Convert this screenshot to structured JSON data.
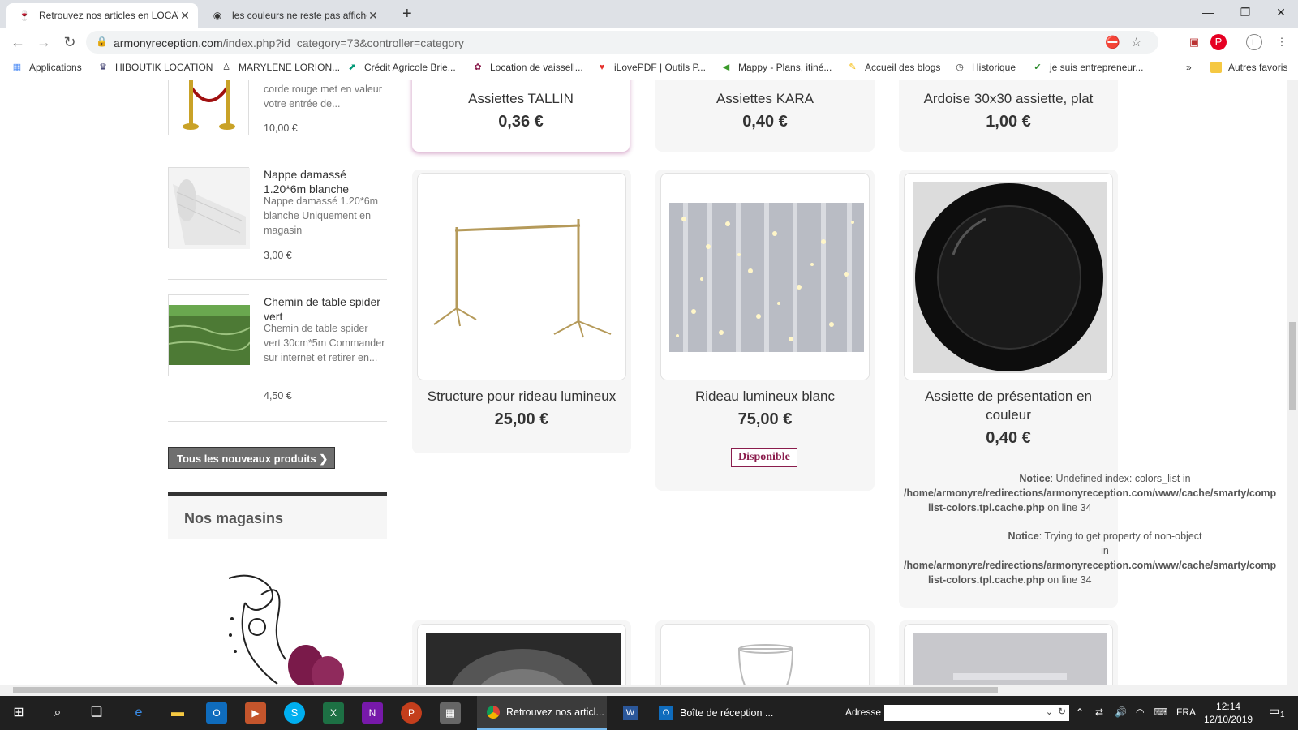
{
  "browser": {
    "tabs": [
      {
        "title": "Retrouvez nos articles en LOCATI",
        "active": true
      },
      {
        "title": "les couleurs ne reste pas affiché",
        "active": false
      }
    ],
    "url_host": "armonyreception.com",
    "url_path": "/index.php?id_category=73&controller=category",
    "bookmarks": [
      {
        "label": "Applications",
        "icon": "apps-grid-icon"
      },
      {
        "label": "HIBOUTIK LOCATION",
        "icon": "owl-icon"
      },
      {
        "label": "MARYLENE LORION...",
        "icon": "person-icon"
      },
      {
        "label": "Crédit Agricole Brie...",
        "icon": "bank-icon"
      },
      {
        "label": "Location de vaissell...",
        "icon": "flower-icon"
      },
      {
        "label": "iLovePDF | Outils P...",
        "icon": "heart-icon"
      },
      {
        "label": "Mappy - Plans, itiné...",
        "icon": "map-icon"
      },
      {
        "label": "Accueil des blogs",
        "icon": "blog-icon"
      },
      {
        "label": "Historique",
        "icon": "history-icon"
      },
      {
        "label": "je suis entrepreneur...",
        "icon": "entrepreneur-icon"
      }
    ],
    "more_bookmarks": "»",
    "other_favorites": "Autres favoris",
    "profile_initial": "L"
  },
  "sidebar": {
    "items": [
      {
        "title": "",
        "desc": "corde rouge met en valeur votre entrée de...",
        "price": "10,00 €"
      },
      {
        "title": "Nappe damassé 1.20*6m blanche",
        "desc": "Nappe damassé 1.20*6m blanche Uniquement en magasin",
        "price": "3,00 €"
      },
      {
        "title": "Chemin de table spider vert",
        "desc": "Chemin de table spider vert 30cm*5m Commander sur internet et retirer en...",
        "price": "4,50 €"
      }
    ],
    "new_products_button": "Tous les nouveaux produits",
    "stores_heading": "Nos magasins"
  },
  "products": {
    "row1": [
      {
        "name": "Assiettes TALLIN",
        "price": "0,36 €"
      },
      {
        "name": "Assiettes KARA",
        "price": "0,40 €"
      },
      {
        "name": "Ardoise 30x30 assiette, plat",
        "price": "1,00 €"
      }
    ],
    "row2": [
      {
        "name": "Structure pour rideau lumineux",
        "price": "25,00 €"
      },
      {
        "name": "Rideau lumineux blanc",
        "price": "75,00 €",
        "availability": "Disponible"
      },
      {
        "name": "Assiette de présentation en couleur",
        "price": "0,40 €"
      }
    ]
  },
  "notices": [
    {
      "label": "Notice",
      "message": ": Undefined index: colors_list in",
      "path": "/home/armonyre/redirections/armonyreception.com/www/cache/smarty/comp",
      "path2": "list-colors.tpl.cache.php",
      "line": " on line 34"
    },
    {
      "label": "Notice",
      "message": ": Trying to get property of non-object",
      "in": "in",
      "path": "/home/armonyre/redirections/armonyreception.com/www/cache/smarty/comp",
      "path2": "list-colors.tpl.cache.php",
      "line": " on line 34"
    }
  ],
  "taskbar": {
    "tasks": [
      {
        "label": "Retrouvez nos articl...",
        "active": true
      },
      {
        "label": "",
        "active": false
      },
      {
        "label": "Boîte de réception ...",
        "active": false
      }
    ],
    "address_label": "Adresse",
    "language": "FRA",
    "time": "12:14",
    "date": "12/10/2019",
    "notifications": "1"
  },
  "colors": {
    "accent": "#8a1c4c",
    "taskbar_bg": "#202020",
    "tab_bg": "#dee1e6"
  }
}
